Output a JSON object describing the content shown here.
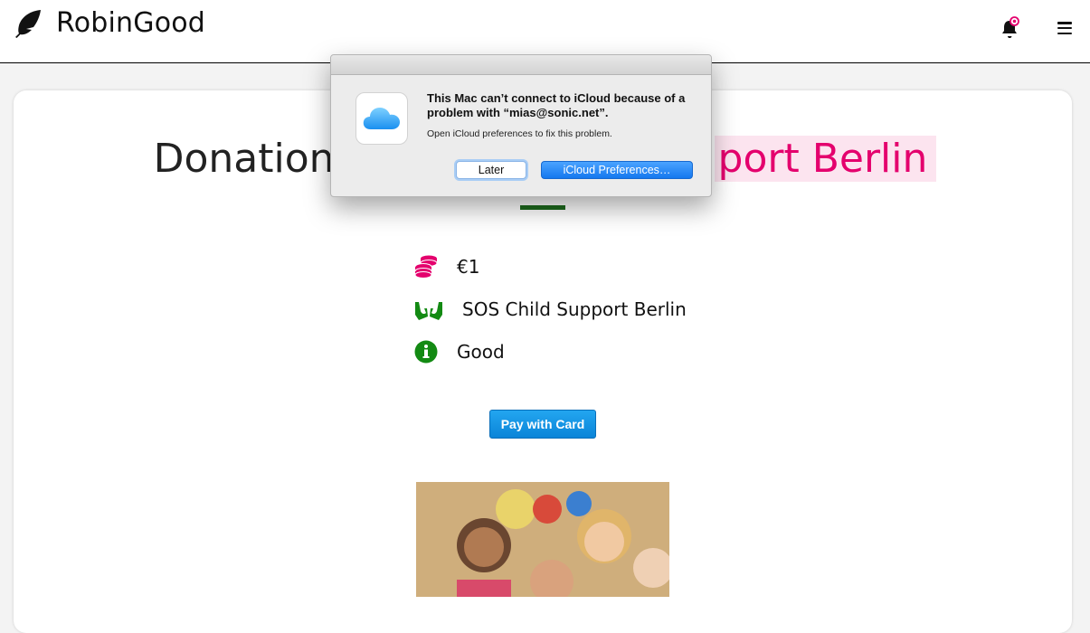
{
  "header": {
    "brand": "RobinGood",
    "icons": {
      "logo": "feather-icon",
      "notification": "bell-icon",
      "menu": "hamburger-menu-icon"
    }
  },
  "main": {
    "title_left": "Donation",
    "title_right": "port Berlin",
    "details": [
      {
        "icon": "coins-icon",
        "text": "€1"
      },
      {
        "icon": "hands-icon",
        "text": "SOS Child Support Berlin"
      },
      {
        "icon": "info-icon",
        "text": "Good"
      }
    ],
    "pay_button": "Pay with Card"
  },
  "dialog": {
    "message": "This Mac can’t connect to iCloud because of a problem with “mias@sonic.net”.",
    "info": "Open iCloud preferences to fix this problem.",
    "later_button": "Later",
    "prefs_button": "iCloud Preferences…",
    "icon": "icloud-icon"
  },
  "colors": {
    "accent_pink": "#e4006d",
    "accent_green": "#138a13",
    "dark_green": "#1d6b1d",
    "button_blue": "#1a8fe3"
  }
}
